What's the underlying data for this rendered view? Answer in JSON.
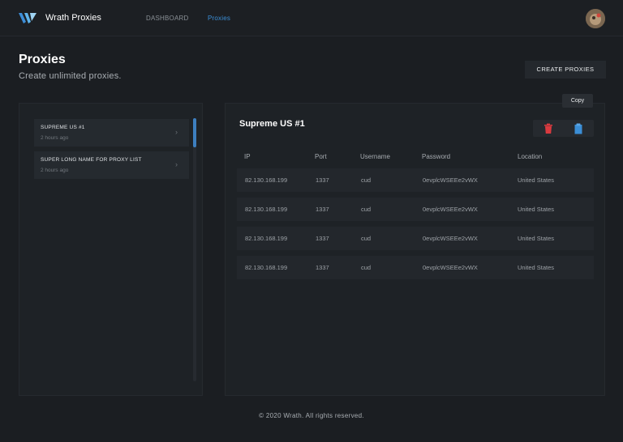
{
  "app": {
    "brand": "Wrath Proxies"
  },
  "nav": {
    "dashboard": "DASHBOARD",
    "proxies": "Proxies"
  },
  "page": {
    "title": "Proxies",
    "subtitle": "Create unlimited proxies.",
    "create_button": "CREATE PROXIES"
  },
  "lists": [
    {
      "name": "SUPREME US #1",
      "time": "2 hours ago"
    },
    {
      "name": "SUPER LONG NAME FOR PROXY LIST",
      "time": "2 hours ago"
    }
  ],
  "detail": {
    "title": "Supreme US #1",
    "tooltip": "Copy",
    "columns": {
      "ip": "IP",
      "port": "Port",
      "username": "Username",
      "password": "Password",
      "location": "Location"
    },
    "rows": [
      {
        "ip": "82.130.168.199",
        "port": "1337",
        "username": "cud",
        "password": "0evplcWSEEe2vWX",
        "location": "United States"
      },
      {
        "ip": "82.130.168.199",
        "port": "1337",
        "username": "cud",
        "password": "0evplcWSEEe2vWX",
        "location": "United States"
      },
      {
        "ip": "82.130.168.199",
        "port": "1337",
        "username": "cud",
        "password": "0evplcWSEEe2vWX",
        "location": "United States"
      },
      {
        "ip": "82.130.168.199",
        "port": "1337",
        "username": "cud",
        "password": "0evplcWSEEe2vWX",
        "location": "United States"
      }
    ]
  },
  "footer": "© 2020 Wrath. All rights reserved.",
  "colors": {
    "accent": "#3b8ed6",
    "delete": "#d93a3f",
    "background": "#1b1e22"
  },
  "icons": {
    "delete": "trash-icon",
    "copy": "clipboard-icon",
    "chevron": "chevron-right-icon"
  }
}
